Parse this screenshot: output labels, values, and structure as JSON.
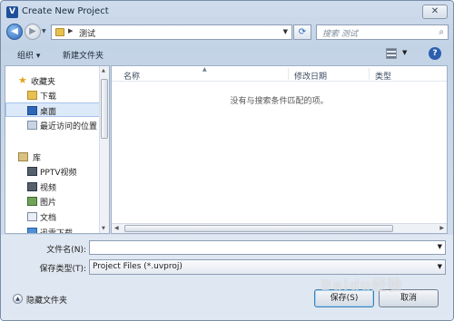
{
  "window": {
    "title": "Create New Project",
    "close_glyph": "✕"
  },
  "address_bar": {
    "path": "测试",
    "search_placeholder": "搜索 测试"
  },
  "toolbar": {
    "organize": "组织 ▾",
    "new_folder": "新建文件夹"
  },
  "sidebar": {
    "items": [
      {
        "label": "收藏夹",
        "icon": "star-icon"
      },
      {
        "label": "下载",
        "icon": "download-folder-icon"
      },
      {
        "label": "桌面",
        "icon": "desktop-icon",
        "selected": true
      },
      {
        "label": "最近访问的位置",
        "icon": "recent-places-icon"
      },
      {
        "label": "库",
        "icon": "library-icon"
      },
      {
        "label": "PPTV视频",
        "icon": "video-library-icon"
      },
      {
        "label": "视频",
        "icon": "video-library-icon"
      },
      {
        "label": "图片",
        "icon": "pictures-library-icon"
      },
      {
        "label": "文档",
        "icon": "documents-library-icon"
      },
      {
        "label": "迅雷下载",
        "icon": "download-folder-icon"
      }
    ]
  },
  "file_list": {
    "columns": [
      "名称",
      "修改日期",
      "类型"
    ],
    "empty_message": "没有与搜索条件匹配的项。"
  },
  "footer": {
    "filename_label": "文件名(N):",
    "filename_value": "",
    "filetype_label": "保存类型(T):",
    "filetype_value": "Project Files (*.uvproj)",
    "hide_folders": "隐藏文件夹",
    "save_button": "保存(S)",
    "cancel_button": "取消"
  },
  "watermark": "Baidu经验",
  "colors": {
    "accent": "#2d5fae",
    "selection": "#dbe9f9",
    "frame": "#c3d3e6"
  }
}
